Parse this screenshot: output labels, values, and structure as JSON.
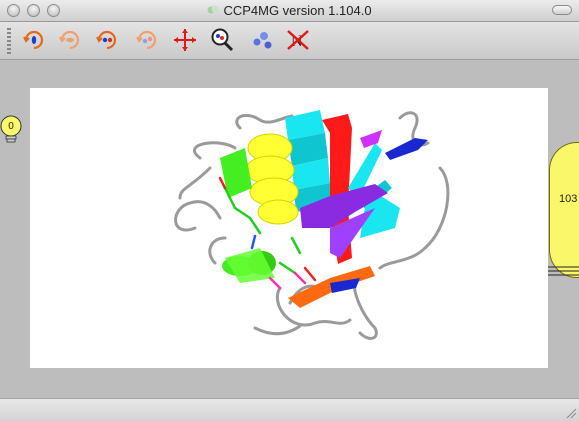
{
  "window": {
    "title": "CCP4MG version 1.104.0"
  },
  "toolbar": {
    "tools": [
      {
        "icon": "rotate-x-icon"
      },
      {
        "icon": "rotate-y-icon"
      },
      {
        "icon": "rotate-z-icon"
      },
      {
        "icon": "rotate-free-icon"
      },
      {
        "icon": "centre-icon"
      },
      {
        "icon": "zoom-icon"
      },
      {
        "icon": "blobs-icon"
      },
      {
        "icon": "no-label-icon"
      }
    ]
  },
  "viewport": {
    "background": "#ffffff"
  },
  "side_controls": {
    "left_bulb_value": "0",
    "right_panel_value": "103"
  },
  "colors": {
    "toolbar_icon_orange": "#e26a1b",
    "red": "#ff1a1a",
    "cyan": "#19e6f0",
    "yellow": "#ffff33",
    "green": "#44ee22",
    "purple": "#8a2be2",
    "blue": "#1a28d0",
    "orange": "#ff6a10",
    "panel_yellow": "#fbf76a"
  }
}
